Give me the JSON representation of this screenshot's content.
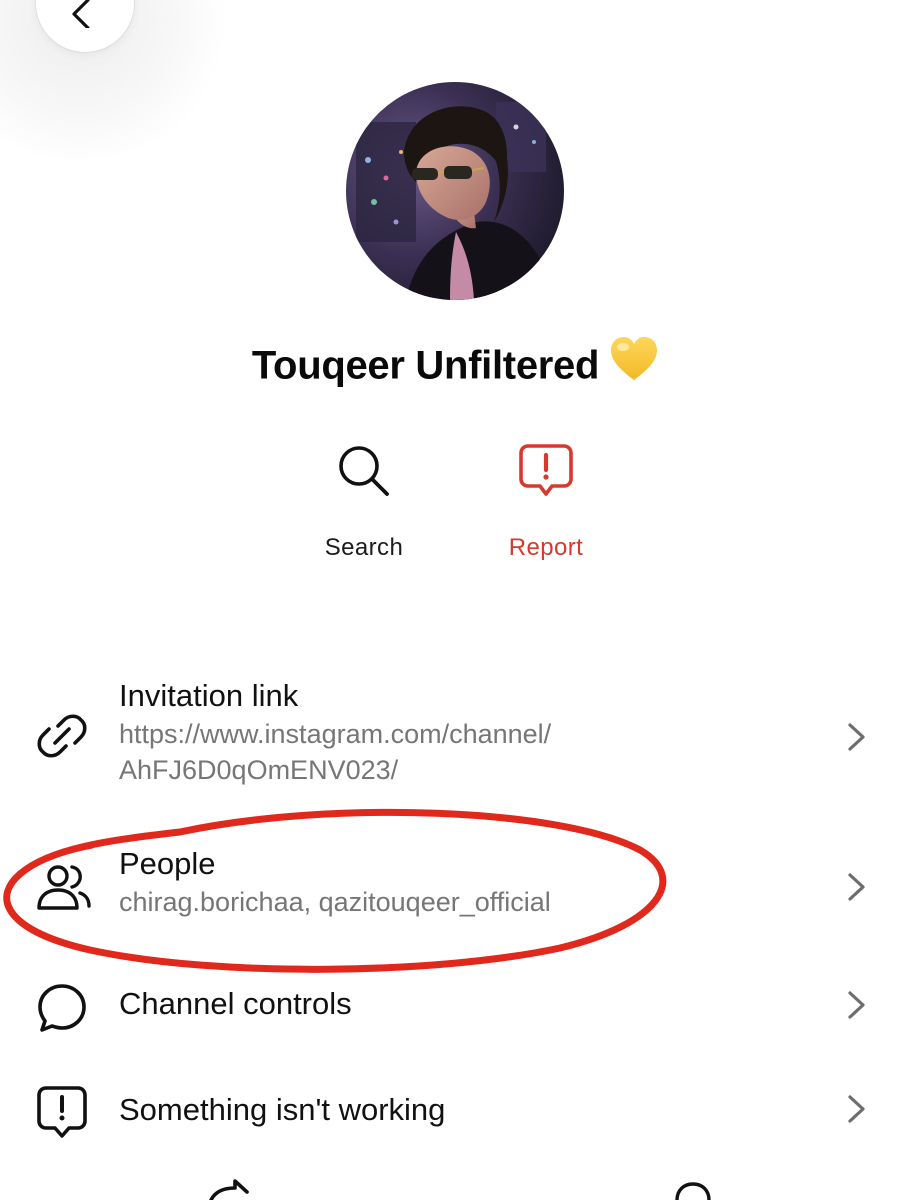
{
  "header": {
    "back_icon": "chevron-left-icon"
  },
  "channel": {
    "avatar_icon": "profile-photo",
    "name": "Touqeer Unfiltered",
    "name_emoji": "yellow-heart-emoji"
  },
  "actions": [
    {
      "label": "Search",
      "icon": "search-icon",
      "color": "#1b1b1b"
    },
    {
      "label": "Report",
      "icon": "report-icon",
      "color": "#d63a2f"
    }
  ],
  "rows": [
    {
      "title": "Invitation link",
      "subtitle_line1": "https://www.instagram.com/channel/",
      "subtitle_line2": "AhFJ6D0qOmENV023/",
      "icon": "link-icon"
    },
    {
      "title": "People",
      "subtitle": "chirag.borichaa, qazitouqeer_official",
      "icon": "people-icon"
    },
    {
      "title": "Channel controls",
      "icon": "chat-bubble-icon"
    },
    {
      "title": "Something isn't working",
      "icon": "alert-bubble-icon"
    }
  ],
  "annotation": {
    "color": "#e0281c"
  }
}
